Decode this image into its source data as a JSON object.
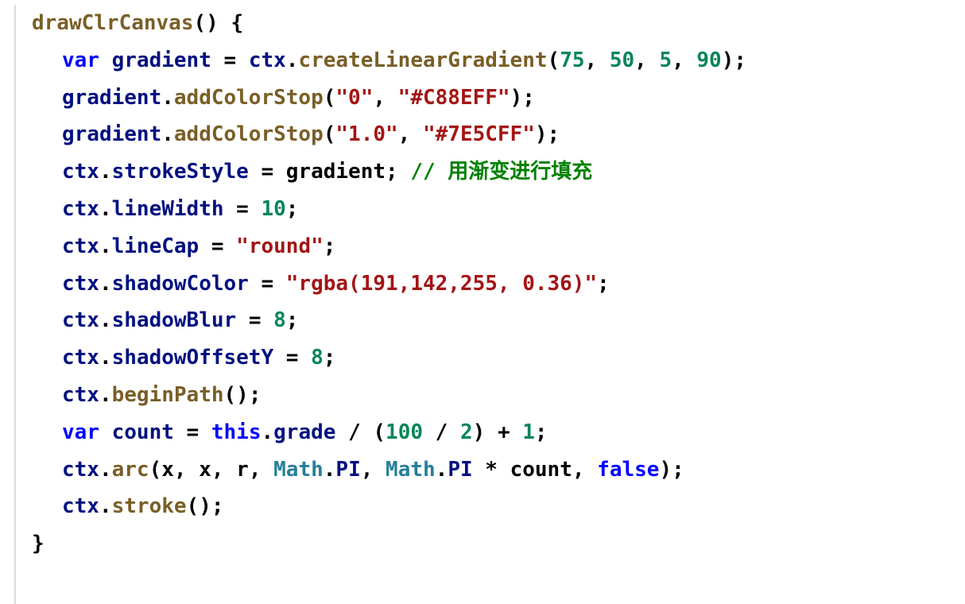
{
  "code": {
    "l01_fn": "drawClrCanvas",
    "l01_rest": "() {",
    "l02_var": "var",
    "l02_id": " gradient ",
    "l02_eq": "= ",
    "l02_ctx": "ctx",
    "l02_dot1": ".",
    "l02_fn": "createLinearGradient",
    "l02_open": "(",
    "l02_a1": "75",
    "l02_c1": ", ",
    "l02_a2": "50",
    "l02_c2": ", ",
    "l02_a3": "5",
    "l02_c3": ", ",
    "l02_a4": "90",
    "l02_close": ");",
    "l03_obj": "gradient",
    "l03_dot": ".",
    "l03_fn": "addColorStop",
    "l03_open": "(",
    "l03_s1": "\"0\"",
    "l03_c": ", ",
    "l03_s2": "\"#C88EFF\"",
    "l03_close": ");",
    "l04_obj": "gradient",
    "l04_dot": ".",
    "l04_fn": "addColorStop",
    "l04_open": "(",
    "l04_s1": "\"1.0\"",
    "l04_c": ", ",
    "l04_s2": "\"#7E5CFF\"",
    "l04_close": ");",
    "l05_ctx": "ctx",
    "l05_dot": ".",
    "l05_prop": "strokeStyle",
    "l05_rest": " = gradient; ",
    "l05_com": "// 用渐变进行填充",
    "l06_ctx": "ctx",
    "l06_dot": ".",
    "l06_prop": "lineWidth",
    "l06_eq": " = ",
    "l06_num": "10",
    "l06_semi": ";",
    "l07_ctx": "ctx",
    "l07_dot": ".",
    "l07_prop": "lineCap",
    "l07_eq": " = ",
    "l07_str": "\"round\"",
    "l07_semi": ";",
    "l08_ctx": "ctx",
    "l08_dot": ".",
    "l08_prop": "shadowColor",
    "l08_eq": " = ",
    "l08_str": "\"rgba(191,142,255, 0.36)\"",
    "l08_semi": ";",
    "l09_ctx": "ctx",
    "l09_dot": ".",
    "l09_prop": "shadowBlur",
    "l09_eq": " = ",
    "l09_num": "8",
    "l09_semi": ";",
    "l10_ctx": "ctx",
    "l10_dot": ".",
    "l10_prop": "shadowOffsetY",
    "l10_eq": " = ",
    "l10_num": "8",
    "l10_semi": ";",
    "l11_ctx": "ctx",
    "l11_dot": ".",
    "l11_fn": "beginPath",
    "l11_rest": "();",
    "l12_var": "var",
    "l12_id": " count ",
    "l12_eq": "= ",
    "l12_this": "this",
    "l12_dot": ".",
    "l12_prop": "grade",
    "l12_op1": " / (",
    "l12_n1": "100",
    "l12_op2": " / ",
    "l12_n2": "2",
    "l12_op3": ") + ",
    "l12_n3": "1",
    "l12_semi": ";",
    "l13_ctx": "ctx",
    "l13_dot": ".",
    "l13_fn": "arc",
    "l13_open": "(x, x, r, ",
    "l13_math1": "Math",
    "l13_d1": ".",
    "l13_pi1": "PI",
    "l13_c2": ", ",
    "l13_math2": "Math",
    "l13_d2": ".",
    "l13_pi2": "PI",
    "l13_mul": " * count, ",
    "l13_false": "false",
    "l13_close": ");",
    "l14_ctx": "ctx",
    "l14_dot": ".",
    "l14_fn": "stroke",
    "l14_rest": "();",
    "l15": "}"
  }
}
